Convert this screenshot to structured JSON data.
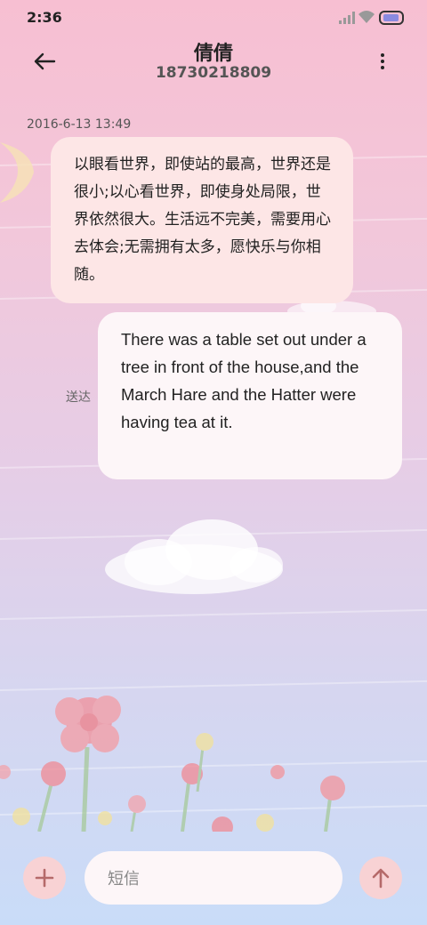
{
  "status_bar": {
    "time": "2:36"
  },
  "header": {
    "contact_name": "倩倩",
    "phone_number": "18730218809"
  },
  "conversation": {
    "timestamp": "2016-6-13 13:49",
    "incoming_message": "以眼看世界，即使站的最高，世界还是很小;以心看世界，即使身处局限，世界依然很大。生活远不完美，需要用心去体会;无需拥有太多，愿快乐与你相随。",
    "outgoing_message": "There was a table set out under a tree in front of the house,and the March Hare and the Hatter were having tea at it.",
    "delivery_status": "送达"
  },
  "composer": {
    "placeholder": "短信"
  },
  "colors": {
    "bubble_incoming": "#fde6e6",
    "bubble_outgoing": "#fdf6f8",
    "button_bg": "#f8d2d4",
    "icon": "#b56a6a"
  },
  "icons": [
    "back-arrow-icon",
    "more-vert-icon",
    "add-icon",
    "send-arrow-icon",
    "signal-icon",
    "wifi-icon",
    "battery-icon"
  ]
}
